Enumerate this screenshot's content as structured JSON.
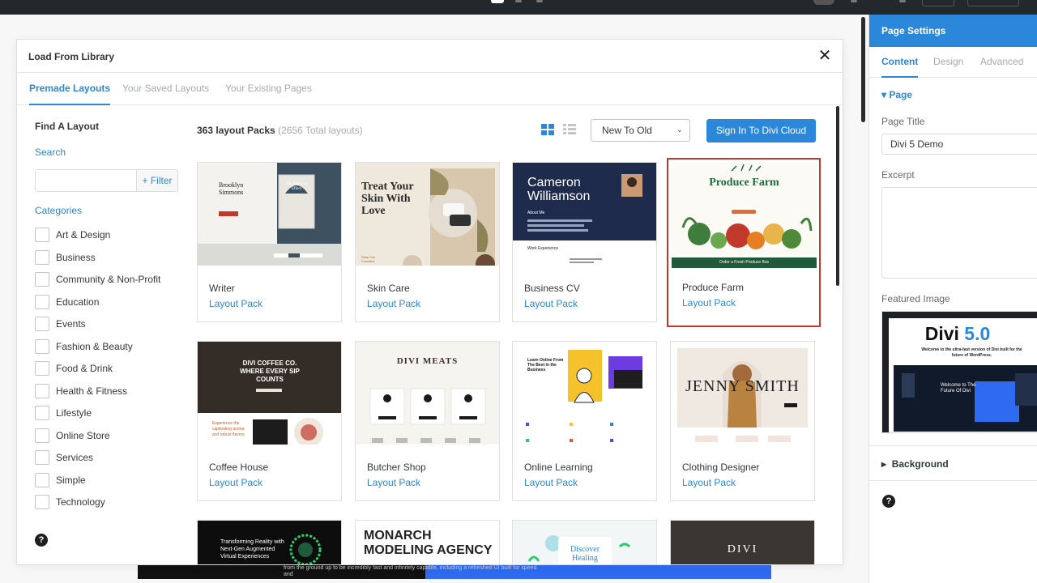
{
  "colors": {
    "accent": "#2b87da",
    "selected_border": "#c0392b",
    "muted": "#a7aaad"
  },
  "modal": {
    "title": "Load From Library",
    "close_icon": "close-icon",
    "tabs": [
      "Premade Layouts",
      "Your Saved Layouts",
      "Your Existing Pages"
    ],
    "active_tab": "Premade Layouts"
  },
  "sidebar": {
    "title": "Find A Layout",
    "search_label": "Search",
    "search_value": "",
    "filter_label": "+ Filter",
    "categories_label": "Categories",
    "categories": [
      "Art & Design",
      "Business",
      "Community & Non-Profit",
      "Education",
      "Events",
      "Fashion & Beauty",
      "Food & Drink",
      "Health & Fitness",
      "Lifestyle",
      "Online Store",
      "Services",
      "Simple",
      "Technology"
    ]
  },
  "toolbar": {
    "count": "363 layout Packs",
    "total": "(2656 Total layouts)",
    "sort_value": "New To Old",
    "cloud_button": "Sign In To Divi Cloud"
  },
  "cards": [
    {
      "name": "Writer",
      "sub": "Layout Pack",
      "thumb": {
        "heading": "Brooklyn Simmons",
        "book": "The Monarch Effect"
      }
    },
    {
      "name": "Skin Care",
      "sub": "Layout Pack",
      "thumb": {
        "heading": "Treat Your Skin With Love",
        "cta": "Shop Our Favorites"
      }
    },
    {
      "name": "Business CV",
      "sub": "Layout Pack",
      "thumb": {
        "heading": "Cameron Williamson",
        "about": "About Me",
        "work": "Work Experience"
      }
    },
    {
      "name": "Produce Farm",
      "sub": "Layout Pack",
      "selected": true,
      "thumb": {
        "heading": "Produce Farm",
        "band": "Order a Fresh Produce Box"
      }
    },
    {
      "name": "Coffee House",
      "sub": "Layout Pack",
      "thumb": {
        "heading": "DIVI COFFEE CO. WHERE EVERY SIP COUNTS",
        "blurb": "Experience the captivating aroma and robust flavors"
      }
    },
    {
      "name": "Butcher Shop",
      "sub": "Layout Pack",
      "thumb": {
        "heading": "DIVI MEATS"
      }
    },
    {
      "name": "Online Learning",
      "sub": "Layout Pack",
      "thumb": {
        "heading": "Learn Online From The Best in the Business"
      }
    },
    {
      "name": "Clothing Designer",
      "sub": "Layout Pack",
      "thumb": {
        "heading": "JENNY SMITH"
      }
    },
    {
      "name": "",
      "sub": "",
      "thumb": {
        "heading": "Transforming Reality with Next-Gen Augmented Virtual Experiences"
      }
    },
    {
      "name": "",
      "sub": "",
      "thumb": {
        "heading": "MONARCH MODELING AGENCY"
      }
    },
    {
      "name": "",
      "sub": "",
      "thumb": {
        "heading": "Discover Healing"
      }
    },
    {
      "name": "",
      "sub": "",
      "thumb": {
        "heading": "DIVI"
      }
    }
  ],
  "page_preview": {
    "text": "from the ground up to be incredibly fast and infinitely capable, including a refreshed UI built for speed and"
  },
  "panel": {
    "title": "Page Settings",
    "tabs": [
      "Content",
      "Design",
      "Advanced"
    ],
    "active_tab": "Content",
    "section_page": "Page",
    "page_title_label": "Page Title",
    "page_title_value": "Divi 5 Demo",
    "excerpt_label": "Excerpt",
    "featured_label": "Featured Image",
    "featured": {
      "brand": "Divi",
      "version": "5.0",
      "tagline": "Welcome to the ultra-fast version of Divi built for the future of WordPress.",
      "screen_text": "Welcome to The Future Of Divi"
    },
    "section_background": "Background"
  }
}
